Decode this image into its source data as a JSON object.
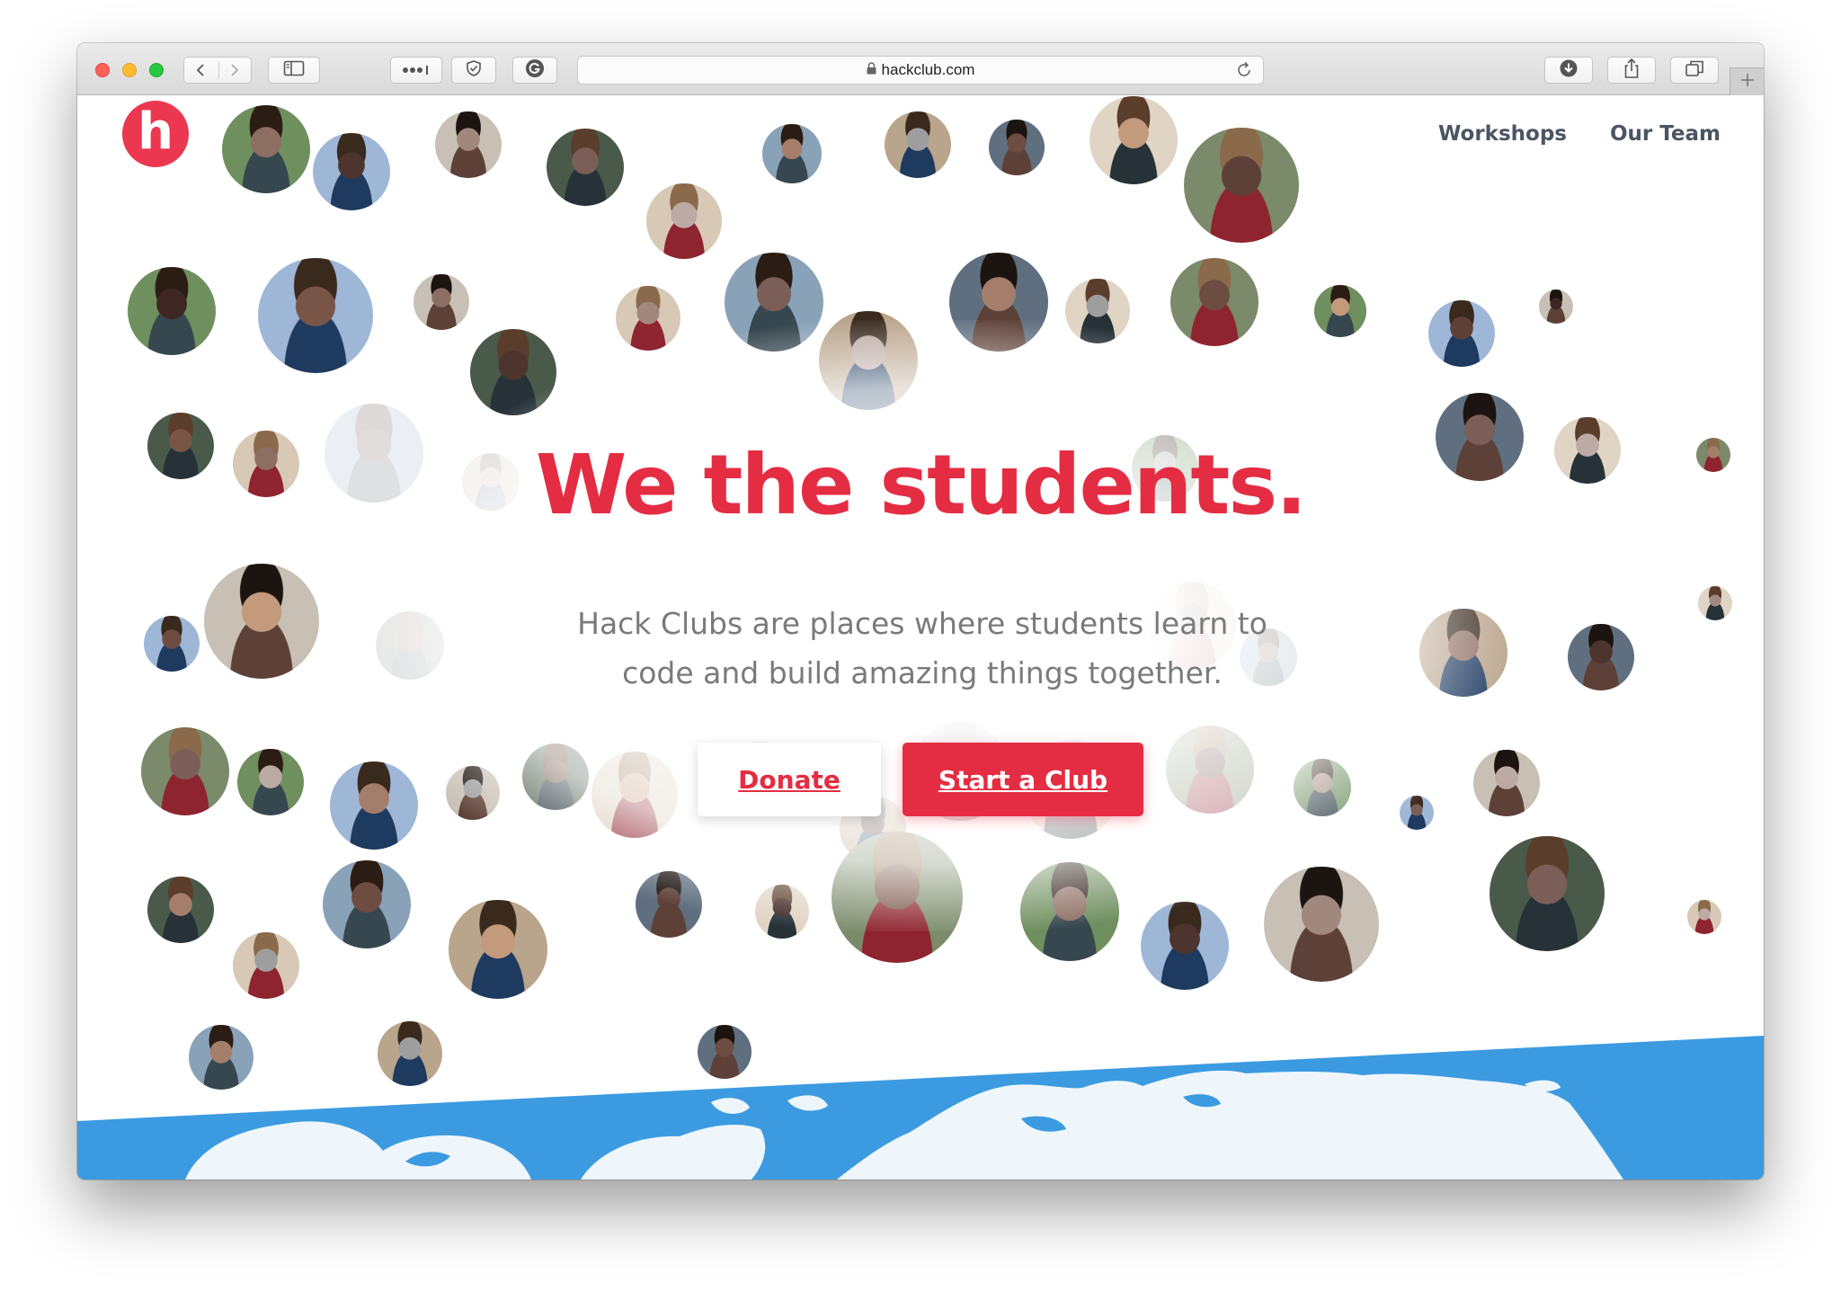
{
  "browser": {
    "url": "hackclub.com",
    "icons": {
      "back": "chevron-left-icon",
      "forward": "chevron-right-icon",
      "sidebar": "sidebar-icon",
      "favorites": "more-dots-icon",
      "shield": "shield-icon",
      "grammarly": "extension-icon",
      "lock": "lock-icon",
      "reload": "reload-icon",
      "download": "download-icon",
      "share": "share-icon",
      "tabs": "tabs-overview-icon",
      "new_tab": "plus-icon"
    }
  },
  "site": {
    "logo_letter": "h",
    "nav": [
      "Workshops",
      "Our Team"
    ],
    "hero": {
      "title": "We the students.",
      "subtitle": "Hack Clubs are places where students learn to code and build amazing things together."
    },
    "buttons": {
      "donate": "Donate",
      "start": "Start a Club"
    }
  },
  "colors": {
    "brand_red": "#ec3750",
    "title_red": "#e42d42",
    "map_blue": "#3c9be0",
    "map_land": "#eef6fc"
  }
}
